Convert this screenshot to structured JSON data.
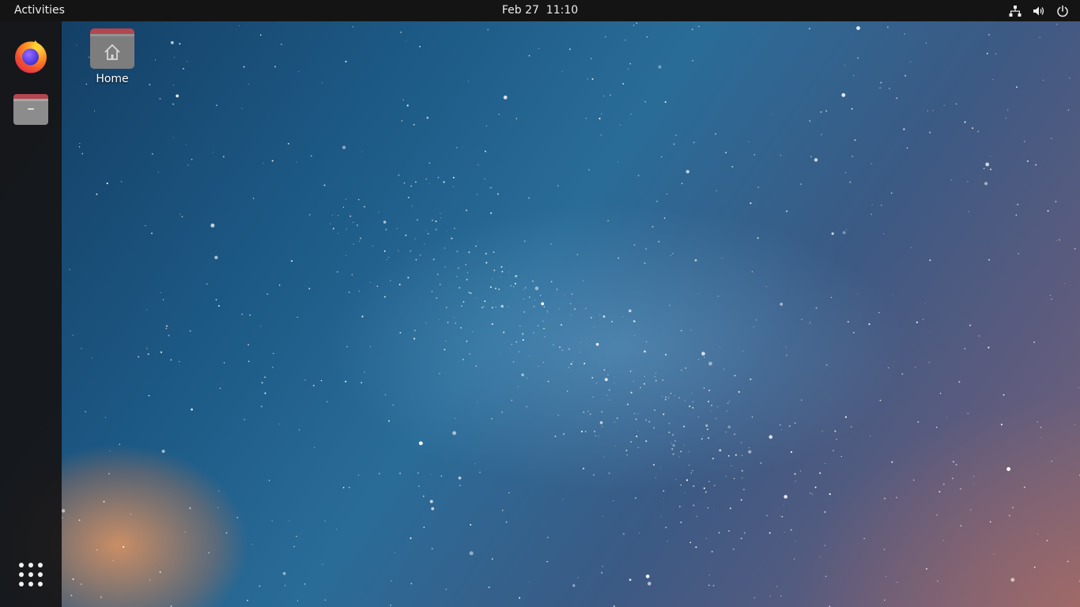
{
  "topbar": {
    "activities_label": "Activities",
    "date": "Feb 27",
    "time": "11:10",
    "tray_icons": [
      "network-icon",
      "volume-icon",
      "power-icon"
    ]
  },
  "dock": {
    "items": [
      {
        "name": "firefox",
        "icon": "firefox-icon"
      },
      {
        "name": "files",
        "icon": "files-icon"
      }
    ],
    "show_apps_icon": "app-grid-icon"
  },
  "desktop": {
    "icons": [
      {
        "label": "Home",
        "icon": "home-folder-icon"
      }
    ]
  },
  "colors": {
    "topbar_bg": "#141414",
    "dock_bg": "#161416",
    "folder_tab": "#b4464f",
    "folder_body": "#7a7a7a"
  }
}
